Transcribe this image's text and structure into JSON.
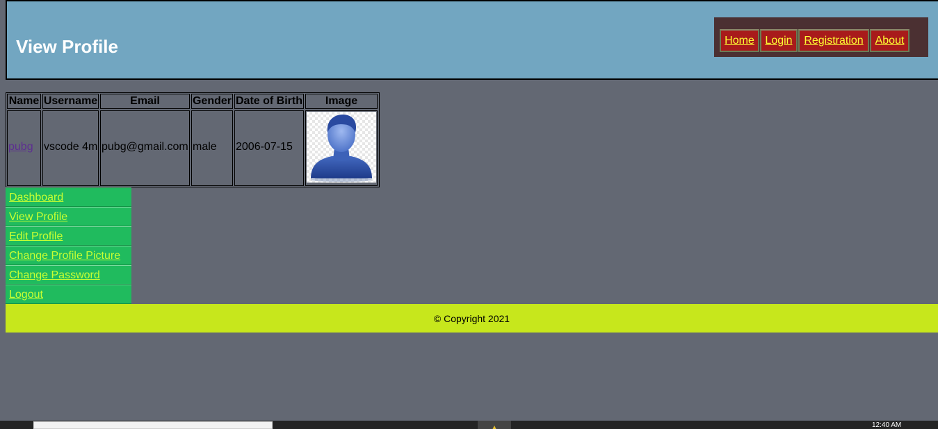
{
  "header": {
    "title": "View Profile",
    "nav": [
      "Home",
      "Login",
      "Registration",
      "About"
    ]
  },
  "profile_table": {
    "headers": [
      "Name",
      "Username",
      "Email",
      "Gender",
      "Date of Birth",
      "Image"
    ],
    "row": {
      "name": "pubg",
      "username": "vscode 4m",
      "email": "pubg@gmail.com",
      "gender": "male",
      "dob": "2006-07-15",
      "image_icon": "user-avatar-icon"
    }
  },
  "sidebar": {
    "items": [
      "Dashboard",
      "View Profile",
      "Edit Profile",
      "Change Profile Picture",
      "Change Password",
      "Logout"
    ]
  },
  "footer": {
    "text": "© Copyright 2021"
  },
  "taskbar": {
    "clock": "12:40 AM"
  },
  "colors": {
    "header_bg": "#72a6c1",
    "page_bg": "#636873",
    "nav_button_bg": "#a81b1b",
    "nav_link": "#ffff33",
    "sidebar_bg": "#20bb5e",
    "sidebar_link": "#c6ff33",
    "footer_bg": "#c7e71c"
  }
}
